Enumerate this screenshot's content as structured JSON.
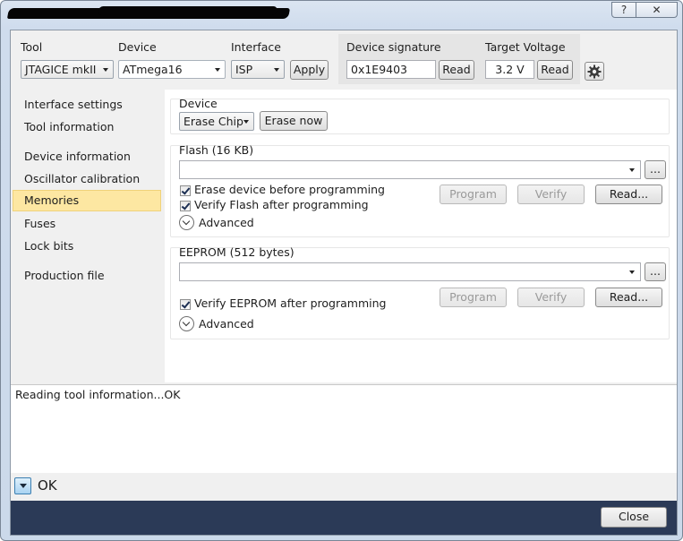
{
  "window": {
    "help_glyph": "?",
    "close_glyph": "✕"
  },
  "toolbar": {
    "tool_label": "Tool",
    "tool_value": "JTAGICE mkII",
    "device_label": "Device",
    "device_value": "ATmega16",
    "interface_label": "Interface",
    "interface_value": "ISP",
    "apply_label": "Apply",
    "signature_label": "Device signature",
    "signature_value": "0x1E9403",
    "signature_read_label": "Read",
    "voltage_label": "Target Voltage",
    "voltage_value": "3.2 V",
    "voltage_read_label": "Read"
  },
  "sidebar": {
    "items": [
      {
        "label": "Interface settings"
      },
      {
        "label": "Tool information"
      },
      {
        "label": "Device information"
      },
      {
        "label": "Oscillator calibration"
      },
      {
        "label": "Memories",
        "active": true
      },
      {
        "label": "Fuses"
      },
      {
        "label": "Lock bits"
      },
      {
        "label": "Production file"
      }
    ]
  },
  "device_group": {
    "title": "Device",
    "erase_select": "Erase Chip",
    "erase_now_label": "Erase now"
  },
  "flash_group": {
    "title": "Flash (16 KB)",
    "file_value": "",
    "browse_label": "...",
    "erase_before_label": "Erase device before programming",
    "erase_before_checked": true,
    "verify_after_label": "Verify Flash after programming",
    "verify_after_checked": true,
    "advanced_label": "Advanced",
    "program_label": "Program",
    "verify_label": "Verify",
    "read_label": "Read..."
  },
  "eeprom_group": {
    "title": "EEPROM (512 bytes)",
    "file_value": "",
    "browse_label": "...",
    "verify_after_label": "Verify EEPROM after programming",
    "verify_after_checked": true,
    "advanced_label": "Advanced",
    "program_label": "Program",
    "verify_label": "Verify",
    "read_label": "Read..."
  },
  "log": {
    "text": "Reading tool information...OK"
  },
  "status": {
    "text": "OK"
  },
  "footer": {
    "close_label": "Close"
  },
  "colors": {
    "footer_bg": "#2b3a57",
    "active_nav_bg": "#fde7a2",
    "window_frame": "#cfdced"
  }
}
